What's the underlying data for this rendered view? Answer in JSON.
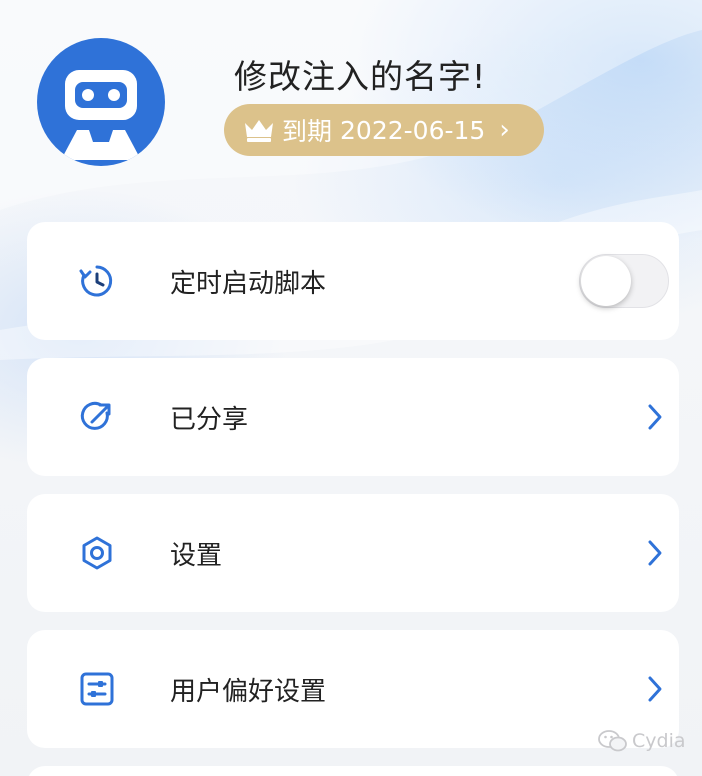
{
  "profile": {
    "username": "修改注入的名字!",
    "expire_label": "到期",
    "expire_date": "2022-06-15",
    "expire_chevron": "›",
    "avatar_icon": "robot-avatar-icon",
    "badge_icon": "crown-icon"
  },
  "menu": {
    "items": [
      {
        "label": "定时启动脚本",
        "icon": "timer-icon",
        "control": "toggle",
        "toggle_on": false
      },
      {
        "label": "已分享",
        "icon": "share-icon",
        "control": "chevron"
      },
      {
        "label": "设置",
        "icon": "hexagon-settings-icon",
        "control": "chevron"
      },
      {
        "label": "用户偏好设置",
        "icon": "sliders-icon",
        "control": "chevron"
      }
    ]
  },
  "watermark": {
    "text": "Cydia",
    "icon": "wechat-icon"
  },
  "colors": {
    "accent": "#2f72d8",
    "badge": "#dcc28b",
    "card": "#ffffff",
    "text": "#222222"
  }
}
